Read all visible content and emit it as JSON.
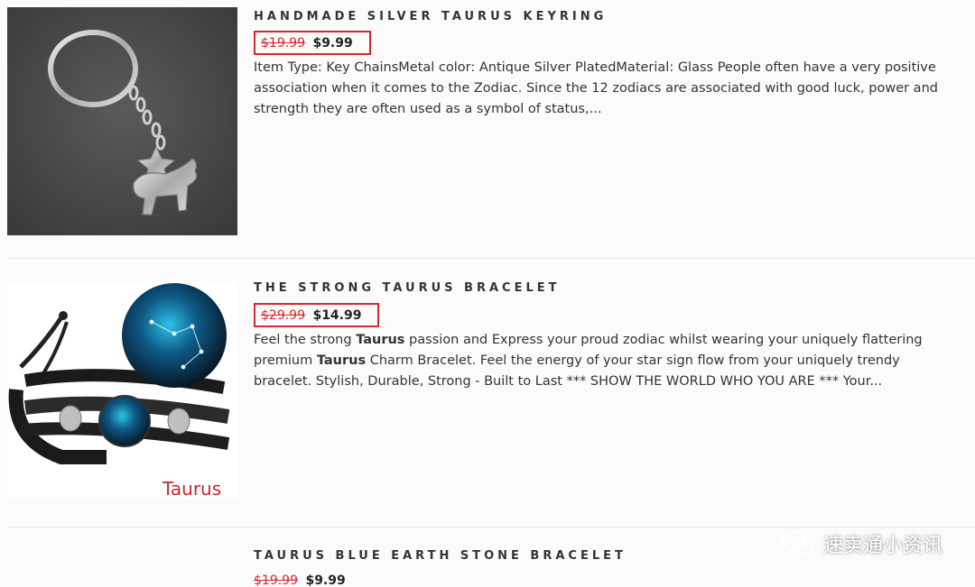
{
  "products": [
    {
      "title": "HANDMADE SILVER TAURUS KEYRING",
      "old_price": "$19.99",
      "new_price": "$9.99",
      "description": "Item Type: Key ChainsMetal color: Antique Silver PlatedMaterial: Glass People often have a very positive association when it comes to the Zodiac. Since the 12 zodiacs are associated with good luck, power and strength they are often used as a symbol of status,..."
    },
    {
      "title": "THE STRONG TAURUS BRACELET",
      "old_price": "$29.99",
      "new_price": "$14.99",
      "description_parts": [
        "Feel the strong ",
        "Taurus",
        " passion and Express your proud zodiac whilst wearing your uniquely flattering premium ",
        "Taurus",
        " Charm Bracelet. Feel the energy of your star sign flow from your uniquely trendy bracelet. Stylish, Durable, Strong - Built to Last *** SHOW THE WORLD WHO YOU ARE *** Your..."
      ],
      "image_label": "Taurus"
    },
    {
      "title": "TAURUS BLUE EARTH STONE BRACELET",
      "old_price": "$19.99",
      "new_price": "$9.99"
    }
  ],
  "watermark": {
    "text": "速卖通小资讯",
    "icon": "wechat-icon"
  },
  "colors": {
    "price_highlight": "#d9272e",
    "old_price": "#d9272e"
  }
}
